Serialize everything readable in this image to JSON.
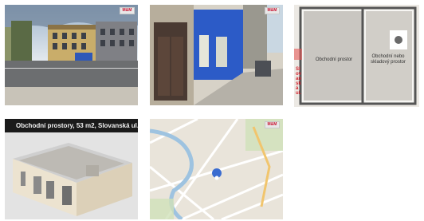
{
  "gallery": {
    "badge_text": "M&M",
    "photos": [
      {
        "name": "street-photo"
      },
      {
        "name": "facade-photo"
      },
      {
        "name": "floorplan",
        "room_main": "Obchodní prostor",
        "room_side": "Obchodní nebo skladový prostor",
        "side_label": "Slovanská ul."
      },
      {
        "name": "model-3d",
        "banner": "Obchodní prostory, 53 m2, Slovanská ul."
      },
      {
        "name": "map"
      }
    ]
  }
}
